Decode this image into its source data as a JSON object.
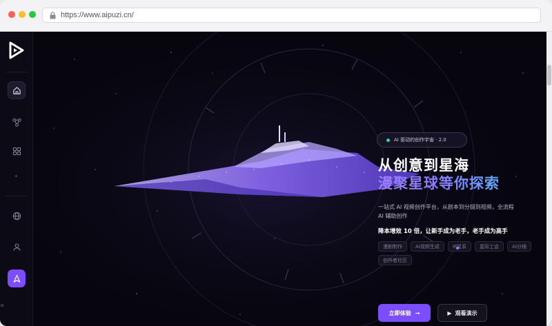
{
  "browser": {
    "url": "https://www.aipuzi.cn/"
  },
  "sidebar": {
    "items": [
      {
        "name": "home",
        "icon": "home-icon"
      },
      {
        "name": "workflow",
        "icon": "nodes-icon"
      },
      {
        "name": "apps",
        "icon": "grid-icon"
      },
      {
        "name": "language",
        "icon": "globe-icon"
      },
      {
        "name": "profile",
        "icon": "user-icon"
      },
      {
        "name": "create",
        "icon": "rocket-icon"
      }
    ],
    "expand_icon": "double-chevron-right-icon"
  },
  "hero": {
    "badge": "AI 驱动的创作宇宙 · 2.0",
    "title_line1": "从创意到星海",
    "title_line2": "漫聚星球等你探索",
    "description": "一站式 AI 视频创作平台，从剧本到分镜到视频，全流程 AI 辅助创作",
    "slogan": "降本增效 10 倍，让新手成为老手，老手成为高手",
    "tags": [
      "漫剧制作",
      "AI视频生成",
      "IP星系",
      "星际工会",
      "AI分镜",
      "创作者社区"
    ],
    "primary_button": "立即体验",
    "primary_arrow": "→",
    "secondary_button": "观看演示",
    "secondary_icon": "▶"
  },
  "colors": {
    "accent": "#7c4dff",
    "background": "#07060f",
    "badge_dot": "#38d39f"
  }
}
